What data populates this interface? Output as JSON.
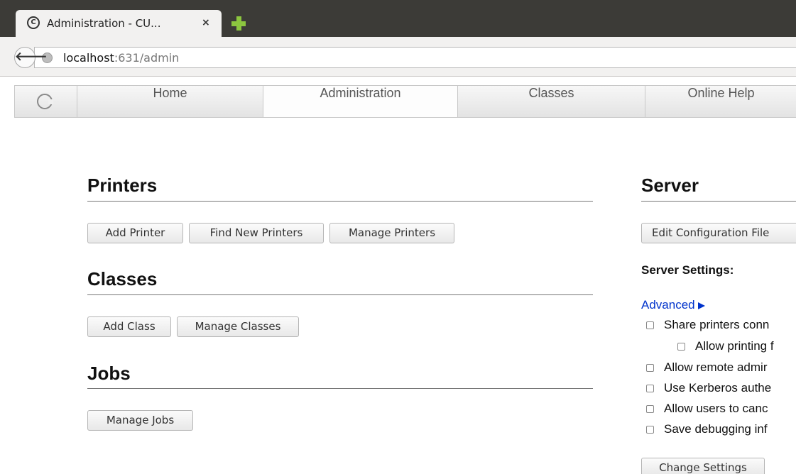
{
  "browser": {
    "tab_title": "Administration - CU...",
    "tab_close": "×",
    "url_host": "localhost",
    "url_rest": ":631/admin"
  },
  "nav": {
    "items": [
      "Home",
      "Administration",
      "Classes",
      "Online Help"
    ],
    "active": "Administration"
  },
  "printers": {
    "heading": "Printers",
    "buttons": [
      "Add Printer",
      "Find New Printers",
      "Manage Printers"
    ]
  },
  "classes": {
    "heading": "Classes",
    "buttons": [
      "Add Class",
      "Manage Classes"
    ]
  },
  "jobs": {
    "heading": "Jobs",
    "buttons": [
      "Manage Jobs"
    ]
  },
  "server": {
    "heading": "Server",
    "edit_config_button": "Edit Configuration File",
    "settings_label": "Server Settings:",
    "advanced_link": "Advanced",
    "checkboxes": [
      "Share printers conn",
      "Allow printing f",
      "Allow remote admir",
      "Use Kerberos authe",
      "Allow users to canc",
      "Save debugging inf"
    ],
    "change_settings_button": "Change Settings"
  },
  "icons": {
    "back": "arrow-left-icon",
    "globe": "globe-icon",
    "new_tab": "plus-icon",
    "cups_logo": "cups-logo-icon"
  },
  "colors": {
    "link": "#0033cc",
    "new_tab_accent": "#8cc63f",
    "tabbar_bg": "#3c3b37"
  }
}
